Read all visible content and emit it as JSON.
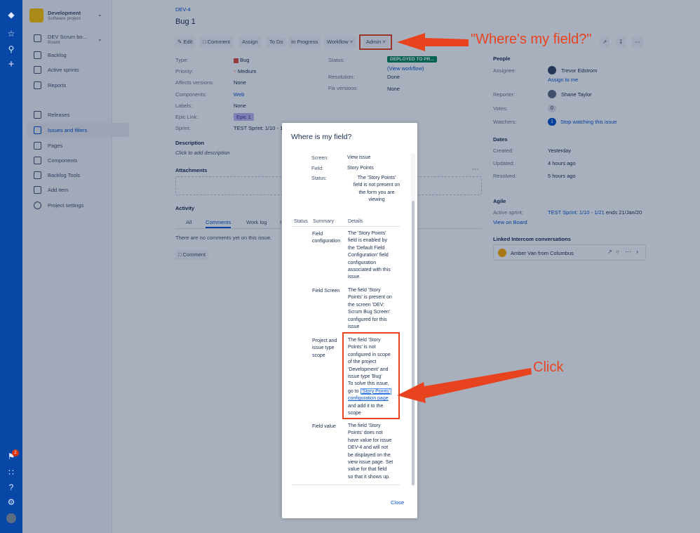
{
  "project": {
    "name": "Development",
    "type": "Software project",
    "board_name": "DEV Scrum bo...",
    "board_type": "Board"
  },
  "sidebar": {
    "items": [
      {
        "label": "Backlog",
        "icon": "backlog-icon"
      },
      {
        "label": "Active sprints",
        "icon": "columns-icon"
      },
      {
        "label": "Reports",
        "icon": "chart-icon"
      },
      {
        "label": "Releases",
        "icon": "ship-icon"
      },
      {
        "label": "Issues and filters",
        "icon": "issues-icon"
      },
      {
        "label": "Pages",
        "icon": "page-icon"
      },
      {
        "label": "Components",
        "icon": "component-icon"
      },
      {
        "label": "Backlog Tools",
        "icon": "tools-icon"
      },
      {
        "label": "Add item",
        "icon": "add-item-icon"
      },
      {
        "label": "Project settings",
        "icon": "gear-icon"
      }
    ]
  },
  "global_nav": {
    "notification_count": "2"
  },
  "issue": {
    "key": "DEV-4",
    "title": "Bug 1",
    "toolbar": {
      "edit": "Edit",
      "comment": "Comment",
      "assign": "Assign",
      "todo": "To Do",
      "in_progress": "In Progress",
      "workflow": "Workflow",
      "admin": "Admin"
    },
    "details": {
      "type_label": "Type:",
      "type_value": "Bug",
      "priority_label": "Priority:",
      "priority_value": "Medium",
      "affects_label": "Affects versions:",
      "affects_value": "None",
      "components_label": "Components:",
      "components_value": "Web",
      "labels_label": "Labels:",
      "labels_value": "None",
      "epic_label": "Epic Link:",
      "epic_value": "Epic 1",
      "sprint_label": "Sprint:",
      "sprint_value": "TEST Sprint: 1/10 - 1",
      "status_label": "Status:",
      "status_value": "DEPLOYED TO PR...",
      "view_workflow": "(View workflow)",
      "resolution_label": "Resolution:",
      "resolution_value": "Done",
      "fix_label": "Fix versions:",
      "fix_value": "None"
    },
    "description_title": "Description",
    "description_placeholder": "Click to add description",
    "attachments_title": "Attachments",
    "activity_title": "Activity",
    "activity_tabs": [
      "All",
      "Comments",
      "Work log",
      "I"
    ],
    "no_comments": "There are no comments yet on this issue.",
    "comment_button": "Comment"
  },
  "people": {
    "title": "People",
    "assignee_label": "Assignee:",
    "assignee": "Trevor Edstrom",
    "assign_to_me": "Assign to me",
    "reporter_label": "Reporter:",
    "reporter": "Shane Taylor",
    "votes_label": "Votes:",
    "votes": "0",
    "watchers_label": "Watchers:",
    "watchers": "1",
    "stop_watching": "Stop watching this issue"
  },
  "dates": {
    "title": "Dates",
    "created_label": "Created:",
    "created": "Yesterday",
    "updated_label": "Updated:",
    "updated": "4 hours ago",
    "resolved_label": "Resolved:",
    "resolved": "5 hours ago"
  },
  "agile": {
    "title": "Agile",
    "active_sprint_label": "Active sprint:",
    "active_sprint": "TEST Sprint: 1/10 - 1/21",
    "ends": "ends 21/Jan/20",
    "view_on_board": "View on Board"
  },
  "intercom": {
    "title": "Linked Intercom conversations",
    "conversation": "Amber Van from Columbus"
  },
  "dialog": {
    "title": "Where is my field?",
    "screen_label": "Screen:",
    "screen_value": "View issue",
    "field_label": "Field:",
    "field_value": "Story Points",
    "status_label": "Status:",
    "status_lines": [
      "The 'Story Points'",
      "field is not present on",
      "the form you are",
      "viewing"
    ],
    "col_status": "Status",
    "col_summary": "Summary",
    "col_details": "Details",
    "rows": [
      {
        "summary": [
          "Field",
          "configuration"
        ],
        "details": [
          "The 'Story Points'",
          "field is enabled by",
          "the 'Default Field",
          "Configuration' field",
          "configuration",
          "associated with this",
          "issue."
        ]
      },
      {
        "summary": [
          "Field Screen"
        ],
        "details": [
          "The field 'Story",
          "Points' is present on",
          "the screen 'DEV:",
          "Scrum Bug Screen'",
          "configured for this",
          "issue"
        ]
      },
      {
        "summary": [
          "Project and",
          "issue type",
          "scope"
        ],
        "details": [
          "The field 'Story",
          "Points' is not",
          "configured in scope",
          "of the project",
          "'Development' and",
          "issue type 'Bug'",
          "To solve this issue,"
        ]
      },
      {
        "summary": [
          "Field value"
        ],
        "details": [
          "The field 'Story",
          "Points' does not",
          "have value for issue",
          "DEV-4 and will not",
          "be displayed on the",
          "view issue page. Set",
          "value for that field",
          "so that it shows up."
        ]
      }
    ],
    "goto_prefix": "go to ",
    "config_link_1": "'Story Points'",
    "config_link_2": "configuration page",
    "after_link_1": "and add it to the",
    "after_link_2": "scope",
    "close": "Close"
  },
  "annotations": {
    "where": "\"Where's my field?\"",
    "click": "Click",
    "color": "#e8431f"
  }
}
